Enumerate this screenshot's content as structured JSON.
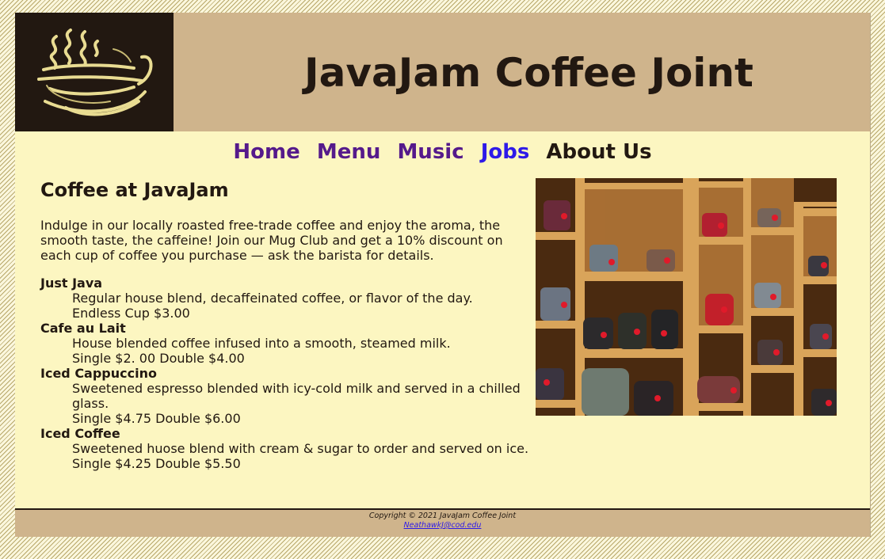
{
  "header": {
    "title": "JavaJam Coffee Joint",
    "logo_icon": "steaming-coffee-cup-icon"
  },
  "nav": {
    "items": [
      {
        "label": "Home",
        "state": "visited"
      },
      {
        "label": "Menu",
        "state": "visited"
      },
      {
        "label": "Music",
        "state": "visited"
      },
      {
        "label": "Jobs",
        "state": "unvisited"
      },
      {
        "label": "About Us",
        "state": "current"
      }
    ]
  },
  "main": {
    "heading": "Coffee at JavaJam",
    "intro": "Indulge in our locally roasted free-trade coffee and enjoy the aroma, the smooth taste, the caffeine! Join our Mug Club and get a 10% discount on each cup of coffee you purchase — ask the barista for details.",
    "menu": [
      {
        "name": "Just Java",
        "description": "Regular house blend, decaffeinated coffee, or flavor of the day.",
        "price": "Endless Cup $3.00"
      },
      {
        "name": "Cafe au Lait",
        "description": "House blended coffee infused into a smooth, steamed milk.",
        "price": "Single $2. 00 Double $4.00"
      },
      {
        "name": "Iced Cappuccino",
        "description": "Sweetened espresso blended with icy-cold milk and served in a chilled glass.",
        "price": "Single $4.75 Double $6.00"
      },
      {
        "name": "Iced Coffee",
        "description": "Sweetened huose blend with cream & sugar to order and served on ice.",
        "price": "Single $4.25 Double $5.50"
      }
    ],
    "photo": "mugs-on-wooden-shelves"
  },
  "footer": {
    "copyright": "Copyright © 2021 JavaJam Coffee Joint",
    "email": "NeathawkJ@cod.edu"
  },
  "colors": {
    "header_bg": "#cfb48c",
    "content_bg": "#fcf6c1",
    "logo_bg": "#221811",
    "text": "#221811",
    "link_visited": "#551a8b",
    "link_unvisited": "#2e1ae8"
  }
}
